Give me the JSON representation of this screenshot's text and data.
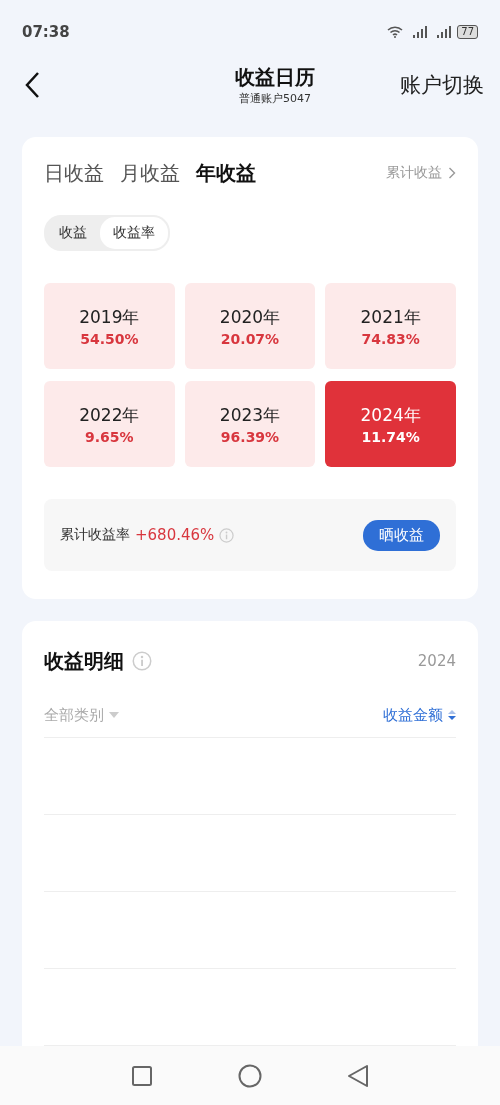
{
  "status_bar": {
    "time": "07:38",
    "battery": "77"
  },
  "header": {
    "title": "收益日历",
    "subtitle": "普通账户5047",
    "action": "账户切换"
  },
  "tabs": [
    {
      "label": "日收益",
      "selected": false
    },
    {
      "label": "月收益",
      "selected": false
    },
    {
      "label": "年收益",
      "selected": true
    }
  ],
  "cumulative_link": "累计收益",
  "toggle": [
    {
      "label": "收益",
      "selected": false
    },
    {
      "label": "收益率",
      "selected": true
    }
  ],
  "years": [
    {
      "year": "2019年",
      "rate": "54.50%",
      "selected": false
    },
    {
      "year": "2020年",
      "rate": "20.07%",
      "selected": false
    },
    {
      "year": "2021年",
      "rate": "74.83%",
      "selected": false
    },
    {
      "year": "2022年",
      "rate": "9.65%",
      "selected": false
    },
    {
      "year": "2023年",
      "rate": "96.39%",
      "selected": false
    },
    {
      "year": "2024年",
      "rate": "11.74%",
      "selected": true
    }
  ],
  "summary": {
    "label": "累计收益率",
    "value": "+680.46%",
    "button": "晒收益"
  },
  "details": {
    "title": "收益明细",
    "year": "2024",
    "filter": "全部类别",
    "sort": "收益金额"
  }
}
